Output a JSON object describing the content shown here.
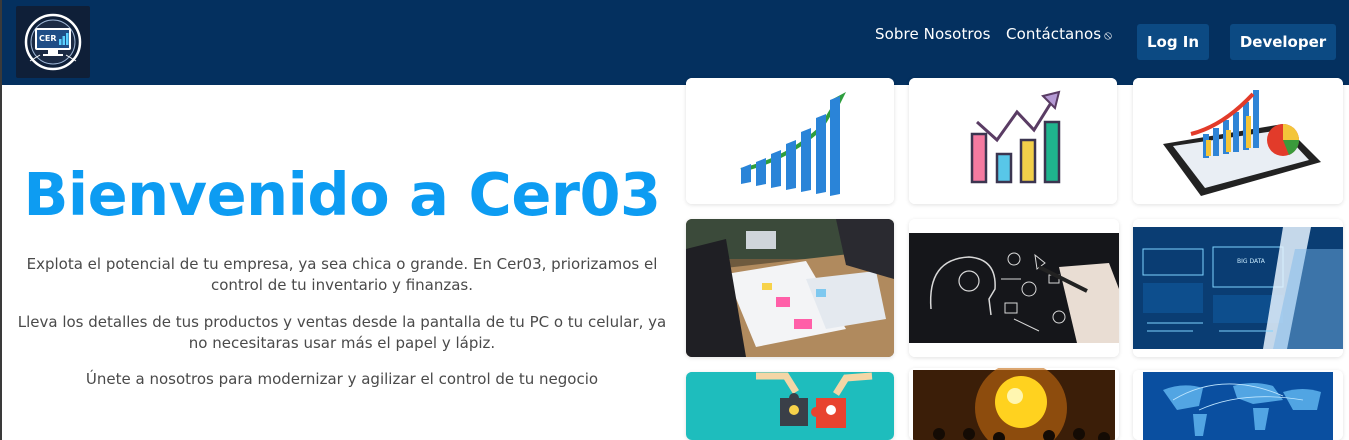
{
  "navbar": {
    "logo_icon": "cer03-logo-icon",
    "about_label": "Sobre Nosotros",
    "contact_label": "Contáctanos",
    "contact_icon": "external-link-icon",
    "login_label": "Log In",
    "developer_label": "Developer",
    "colors": {
      "background": "#04305f",
      "button": "#0c4a83"
    }
  },
  "hero": {
    "title": "Bienvenido a Cer03",
    "paragraph_1": "Explota el potencial de tu empresa, ya sea chica o grande. En Cer03, priorizamos el control de tu inventario y finanzas.",
    "paragraph_2": "Lleva los detalles de tus productos y ventas desde la pantalla de tu PC o tu celular, ya no necesitaras usar más el papel y lápiz.",
    "paragraph_3": "Únete a nosotros para modernizar y agilizar el control de tu negocio",
    "title_color": "#0d9cf2"
  },
  "gallery": {
    "images": [
      {
        "icon": "growth-bar-chart-image"
      },
      {
        "icon": "line-bar-chart-image"
      },
      {
        "icon": "tablet-chart-image"
      },
      {
        "icon": "business-meeting-image"
      },
      {
        "icon": "idea-sketch-image"
      },
      {
        "icon": "big-data-image"
      },
      {
        "icon": "puzzle-teamwork-image"
      },
      {
        "icon": "lightbulb-image"
      },
      {
        "icon": "world-map-image"
      }
    ]
  }
}
